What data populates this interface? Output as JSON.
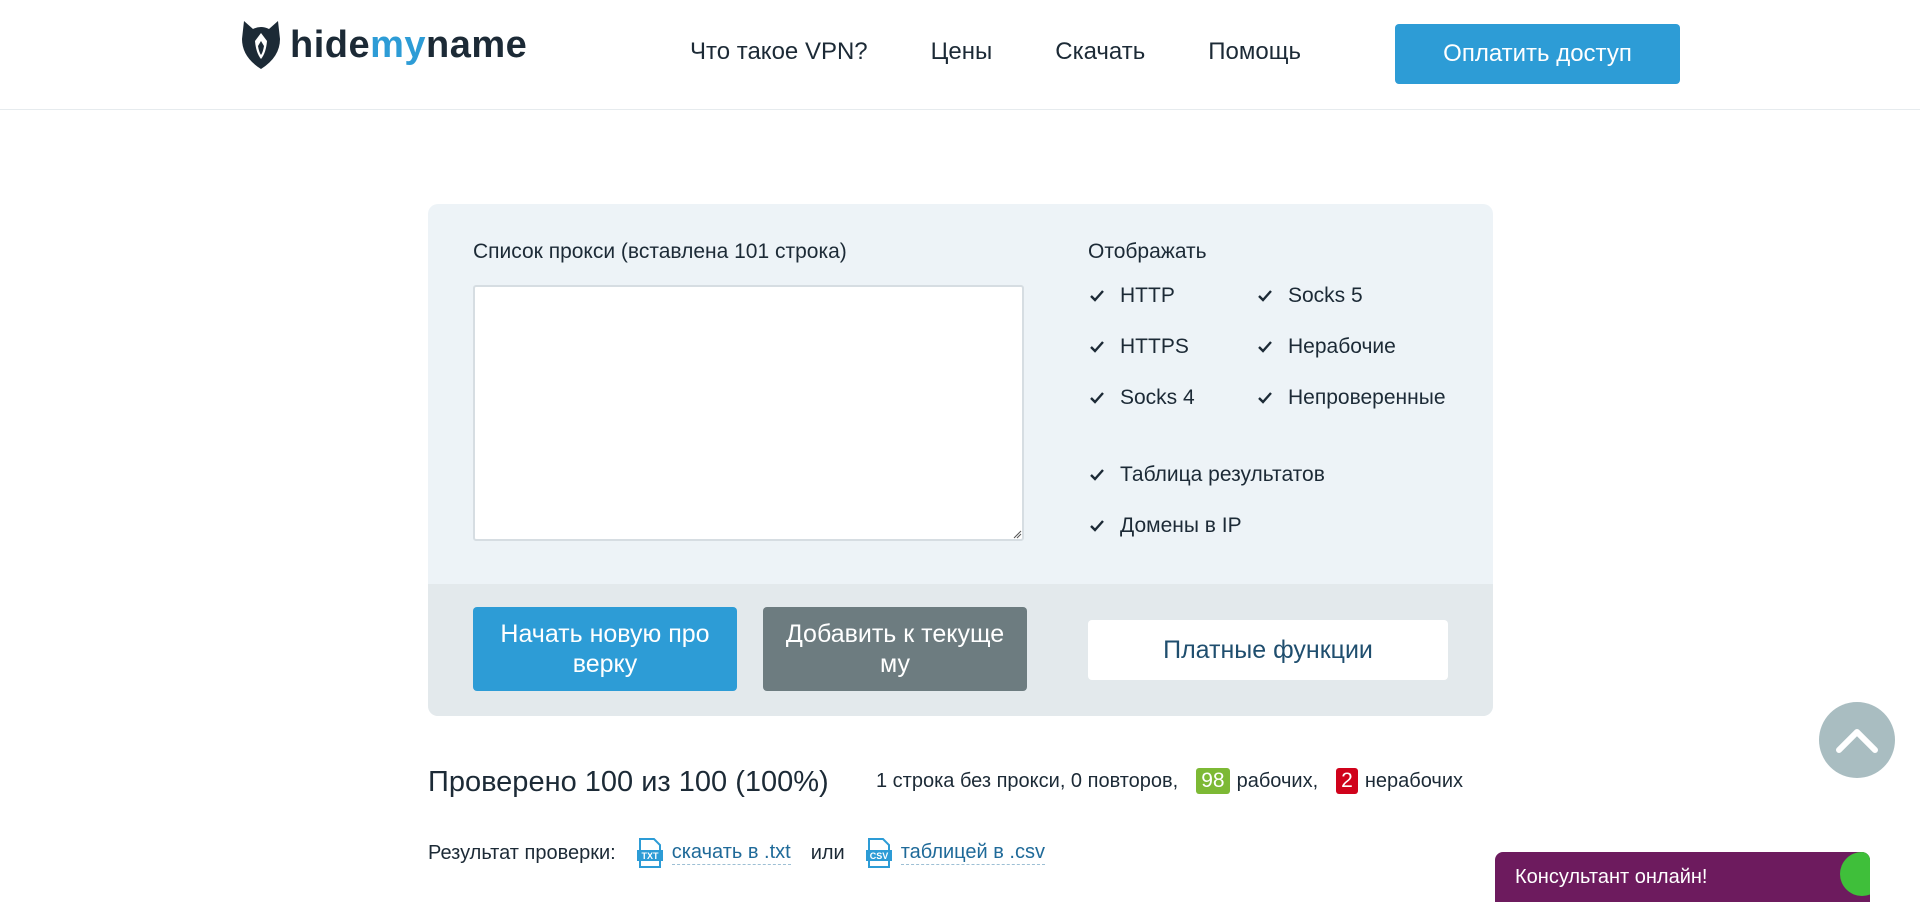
{
  "header": {
    "logo": {
      "part1": "hide",
      "part2": "my",
      "part3": "name"
    },
    "nav": [
      "Что такое VPN?",
      "Цены",
      "Скачать",
      "Помощь"
    ],
    "pay_button": "Оплатить доступ",
    "accent_color": "#2d9cd6"
  },
  "checker": {
    "list_label": "Список прокси (вставлена 101 строка)",
    "textarea_value": "",
    "show_label": "Отображать",
    "filters": {
      "http": "HTTP",
      "socks5": "Socks 5",
      "https": "HTTPS",
      "nonworking": "Нерабочие",
      "socks4": "Socks 4",
      "unchecked": "Непроверенные",
      "results_table": "Таблица результатов",
      "domains_ip": "Домены в IP"
    },
    "start_button": "Начать новую про верку",
    "add_button": "Добавить к текуще му",
    "paid_button": "Платные функции"
  },
  "stats": {
    "title": "Проверено 100 из 100 (100%)",
    "summary": "1 строка без прокси, 0 повторов,",
    "working_count": "98",
    "working_label": "рабочих,",
    "nonworking_count": "2",
    "nonworking_label": "нерабочих"
  },
  "result": {
    "label": "Результат проверки:",
    "txt_icon": "TXT",
    "txt_link": "скачать в .txt",
    "or": "или",
    "csv_icon": "CSV",
    "csv_link": "таблицей в .csv"
  },
  "consultant": "Консультант онлайн!"
}
